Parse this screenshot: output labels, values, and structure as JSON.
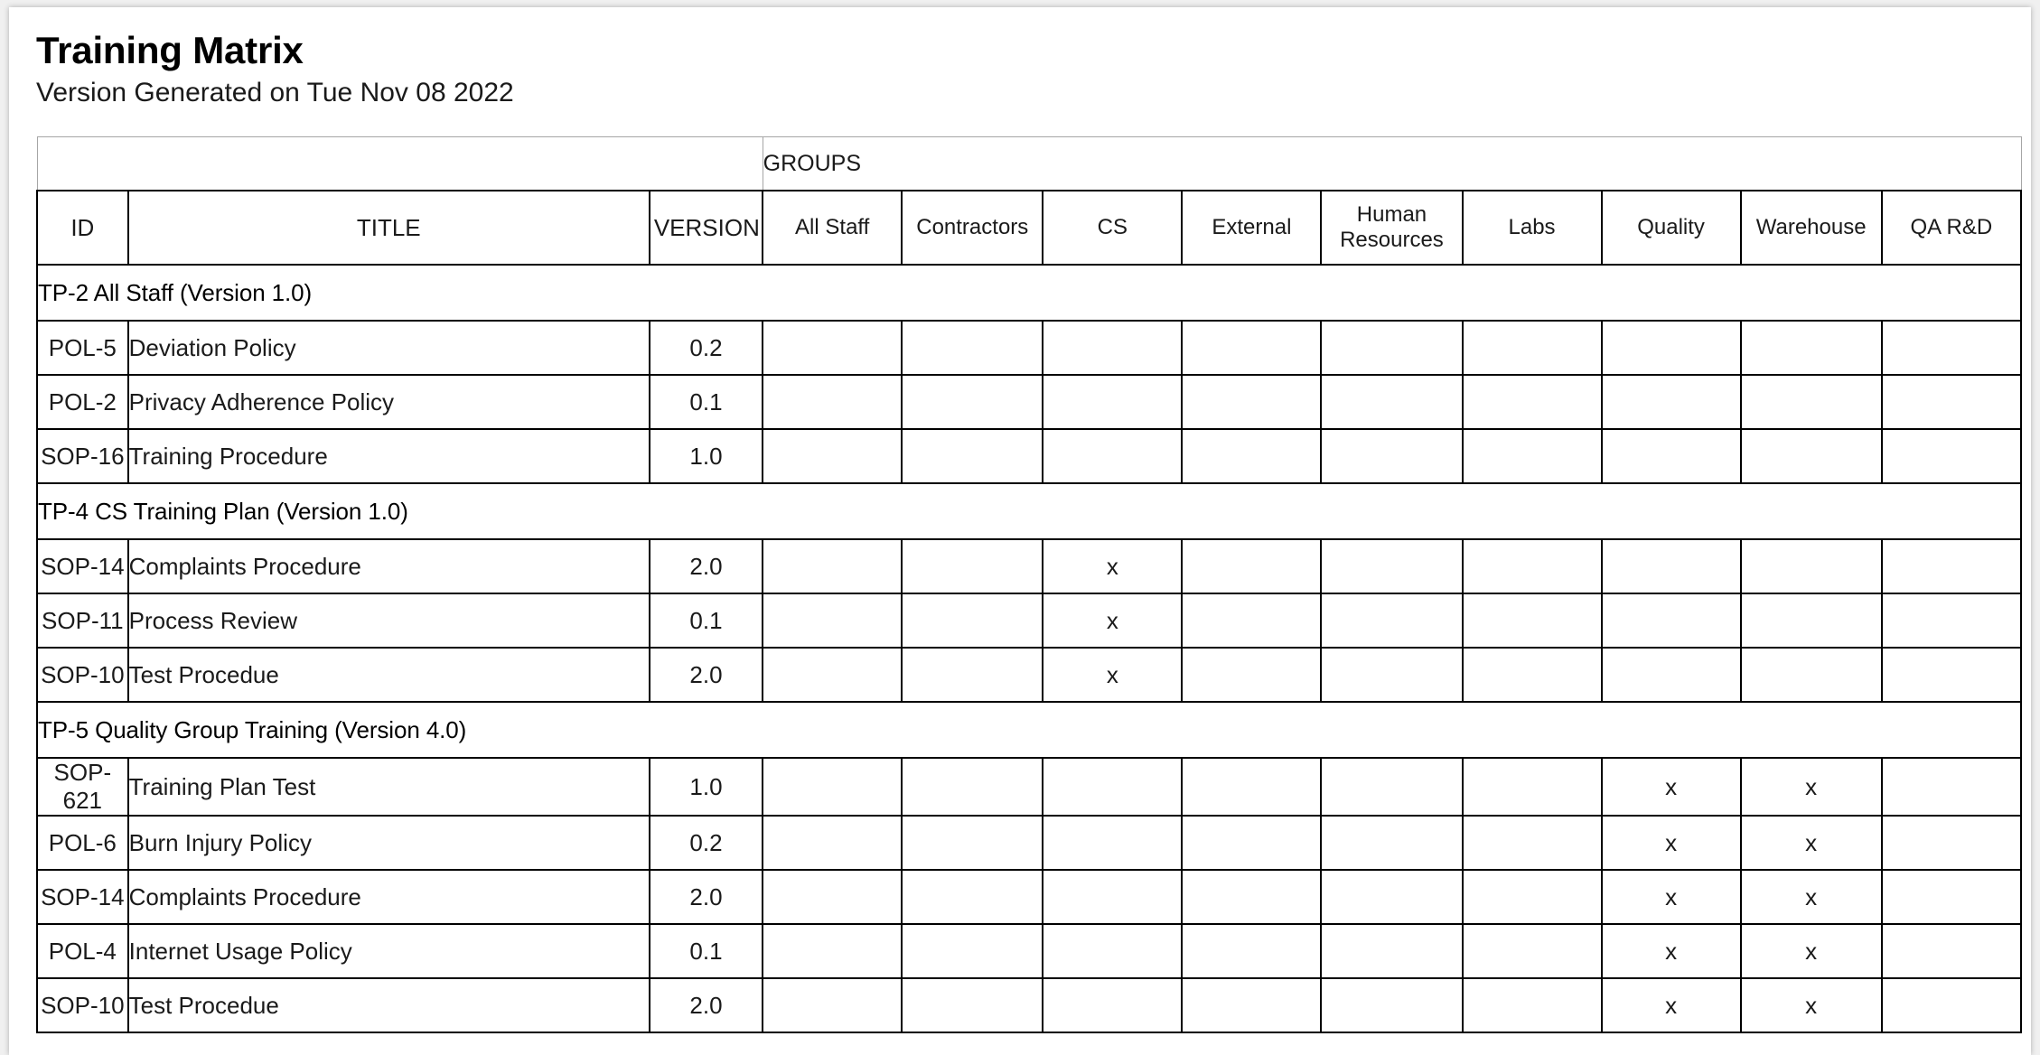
{
  "document": {
    "title": "Training Matrix",
    "subtitle": "Version Generated on Tue Nov 08 2022"
  },
  "table": {
    "band_label": "GROUPS",
    "columns": {
      "id": "ID",
      "title": "TITLE",
      "version": "VERSION"
    },
    "group_columns": [
      "All Staff",
      "Contractors",
      "CS",
      "External",
      "Human Resources",
      "Labs",
      "Quality",
      "Warehouse",
      "QA R&D"
    ],
    "mark": "x",
    "sections": [
      {
        "heading": "TP-2 All Staff (Version 1.0)",
        "rows": [
          {
            "id": "POL-5",
            "title": "Deviation Policy",
            "version": "0.2",
            "groups": [
              "",
              "",
              "",
              "",
              "",
              "",
              "",
              "",
              ""
            ]
          },
          {
            "id": "POL-2",
            "title": "Privacy Adherence Policy",
            "version": "0.1",
            "groups": [
              "",
              "",
              "",
              "",
              "",
              "",
              "",
              "",
              ""
            ]
          },
          {
            "id": "SOP-16",
            "title": "Training Procedure",
            "version": "1.0",
            "groups": [
              "",
              "",
              "",
              "",
              "",
              "",
              "",
              "",
              ""
            ]
          }
        ]
      },
      {
        "heading": "TP-4 CS Training Plan (Version 1.0)",
        "rows": [
          {
            "id": "SOP-14",
            "title": "Complaints Procedure",
            "version": "2.0",
            "groups": [
              "",
              "",
              "x",
              "",
              "",
              "",
              "",
              "",
              ""
            ]
          },
          {
            "id": "SOP-11",
            "title": "Process Review",
            "version": "0.1",
            "groups": [
              "",
              "",
              "x",
              "",
              "",
              "",
              "",
              "",
              ""
            ]
          },
          {
            "id": "SOP-10",
            "title": "Test Procedue",
            "version": "2.0",
            "groups": [
              "",
              "",
              "x",
              "",
              "",
              "",
              "",
              "",
              ""
            ]
          }
        ]
      },
      {
        "heading": "TP-5 Quality Group Training (Version 4.0)",
        "rows": [
          {
            "id": "SOP-621",
            "title": "Training Plan Test",
            "version": "1.0",
            "groups": [
              "",
              "",
              "",
              "",
              "",
              "",
              "x",
              "x",
              ""
            ]
          },
          {
            "id": "POL-6",
            "title": "Burn Injury Policy",
            "version": "0.2",
            "groups": [
              "",
              "",
              "",
              "",
              "",
              "",
              "x",
              "x",
              ""
            ]
          },
          {
            "id": "SOP-14",
            "title": "Complaints Procedure",
            "version": "2.0",
            "groups": [
              "",
              "",
              "",
              "",
              "",
              "",
              "x",
              "x",
              ""
            ]
          },
          {
            "id": "POL-4",
            "title": "Internet Usage Policy",
            "version": "0.1",
            "groups": [
              "",
              "",
              "",
              "",
              "",
              "",
              "x",
              "x",
              ""
            ]
          },
          {
            "id": "SOP-10",
            "title": "Test Procedue",
            "version": "2.0",
            "groups": [
              "",
              "",
              "",
              "",
              "",
              "",
              "x",
              "x",
              ""
            ]
          }
        ]
      }
    ]
  },
  "colors": {
    "section_band": "#dae4f8",
    "page_background": "#ffffff",
    "grid_line": "#000000",
    "band_line": "#a6a6a6"
  }
}
